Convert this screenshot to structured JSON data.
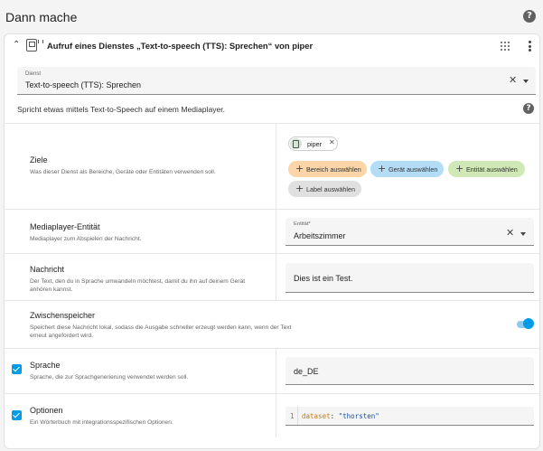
{
  "header": {
    "title": "Dann mache",
    "help_icon": "help-circle-icon"
  },
  "action": {
    "title": "Aufruf eines Dienstes „Text-to-speech (TTS): Sprechen“ von piper",
    "icons": {
      "collapse": "chevron-up-icon",
      "service": "service-icon",
      "drag": "drag-handle-icon",
      "menu": "dots-vertical-icon"
    }
  },
  "service_field": {
    "label": "Dienst",
    "value": "Text-to-speech (TTS): Sprechen"
  },
  "service_description": "Spricht etwas mittels Text-to-Speech auf einem Mediaplayer.",
  "targets": {
    "title": "Ziele",
    "description": "Was dieser Dienst als Bereiche, Geräte oder Entitäten verwenden soll.",
    "chip_label": "piper",
    "buttons": {
      "area": "Bereich auswählen",
      "device": "Gerät auswählen",
      "entity": "Entität auswählen",
      "label": "Label auswählen"
    },
    "colors": {
      "area": "#fbd5a7",
      "device": "#b3dcf6",
      "entity": "#cfe8b5",
      "label": "#e0e0e0"
    }
  },
  "media_player": {
    "title": "Mediaplayer-Entität",
    "description": "Mediaplayer zum Abspielen der Nachricht.",
    "field_label": "Entität*",
    "value": "Arbeitszimmer"
  },
  "message": {
    "title": "Nachricht",
    "description": "Der Text, den du in Sprache umwandeln möchtest, damit du ihn auf deinem Gerät anhören kannst.",
    "value": "Dies ist ein Test."
  },
  "cache": {
    "title": "Zwischenspeicher",
    "description": "Speichert diese Nachricht lokal, sodass die Ausgabe schneller erzeugt werden kann, wenn der Text erneut angefordert wird.",
    "enabled": true
  },
  "language": {
    "title": "Sprache",
    "description": "Sprache, die zur Sprachgenerierung verwendet werden soll.",
    "value": "de_DE",
    "checked": true
  },
  "options": {
    "title": "Optionen",
    "description": "Ein Wörterbuch mit integrationsspezifischen Optionen.",
    "checked": true,
    "code": {
      "line_number": "1",
      "key": "dataset",
      "colon": ": ",
      "value": "\"thorsten\""
    }
  },
  "accent_color": "#039be5"
}
